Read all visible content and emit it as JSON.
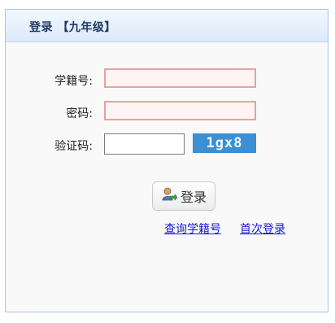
{
  "panel": {
    "title": "登录 【九年级】"
  },
  "form": {
    "student_id_label": "学籍号:",
    "student_id_value": "",
    "password_label": "密码:",
    "password_value": "",
    "captcha_label": "验证码:",
    "captcha_value": "",
    "captcha_text": "1gx8"
  },
  "actions": {
    "login_label": "登录",
    "query_student_id_link": "查询学籍号",
    "first_login_link": "首次登录"
  },
  "colors": {
    "required_field_border": "#e5a3a3",
    "required_field_background": "#fff3f3",
    "captcha_background": "#3b8fd2",
    "link": "#1a1acc",
    "header_gradient_bottom": "#dce9fa"
  },
  "icons": {
    "login_button_icon": "user-login-icon"
  }
}
